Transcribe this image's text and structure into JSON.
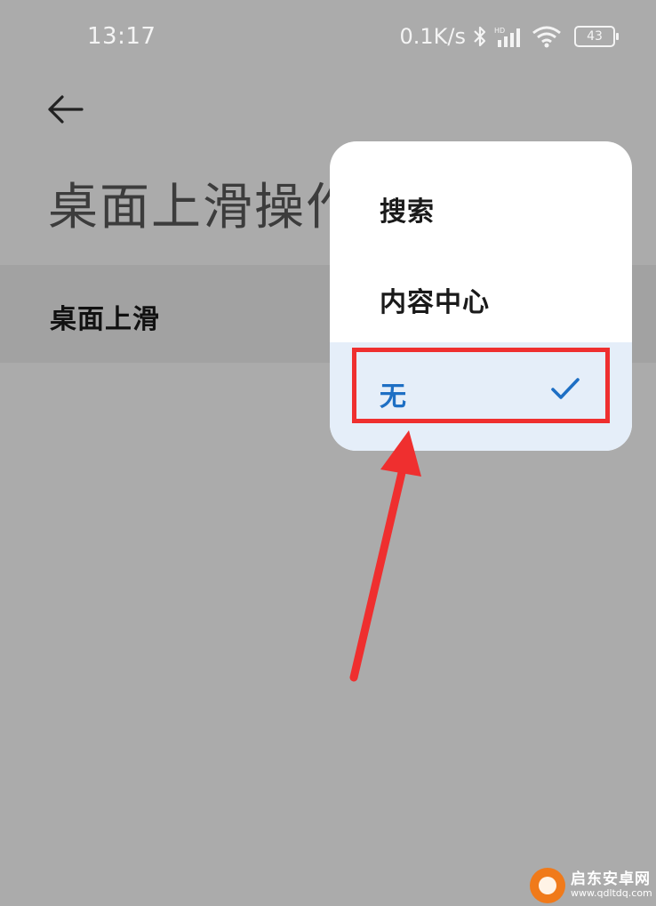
{
  "status_bar": {
    "time": "13:17",
    "net_speed": "0.1K/s",
    "battery": "43",
    "icons": [
      "bluetooth-icon",
      "hd-signal-icon",
      "wifi-icon",
      "battery-icon"
    ]
  },
  "header": {
    "back_icon": "arrow-left-icon",
    "title": "桌面上滑操作"
  },
  "setting": {
    "label": "桌面上滑"
  },
  "popup": {
    "items": [
      {
        "label": "搜索",
        "selected": false
      },
      {
        "label": "内容中心",
        "selected": false
      },
      {
        "label": "无",
        "selected": true
      }
    ],
    "selected_icon": "check-icon"
  },
  "colors": {
    "accent": "#1e6fc4",
    "annotation": "#ef2f2f",
    "dim_background": "#ababab",
    "selected_background": "#e5eef9"
  },
  "watermark": {
    "name": "启东安卓网",
    "url": "www.qdltdq.com"
  }
}
